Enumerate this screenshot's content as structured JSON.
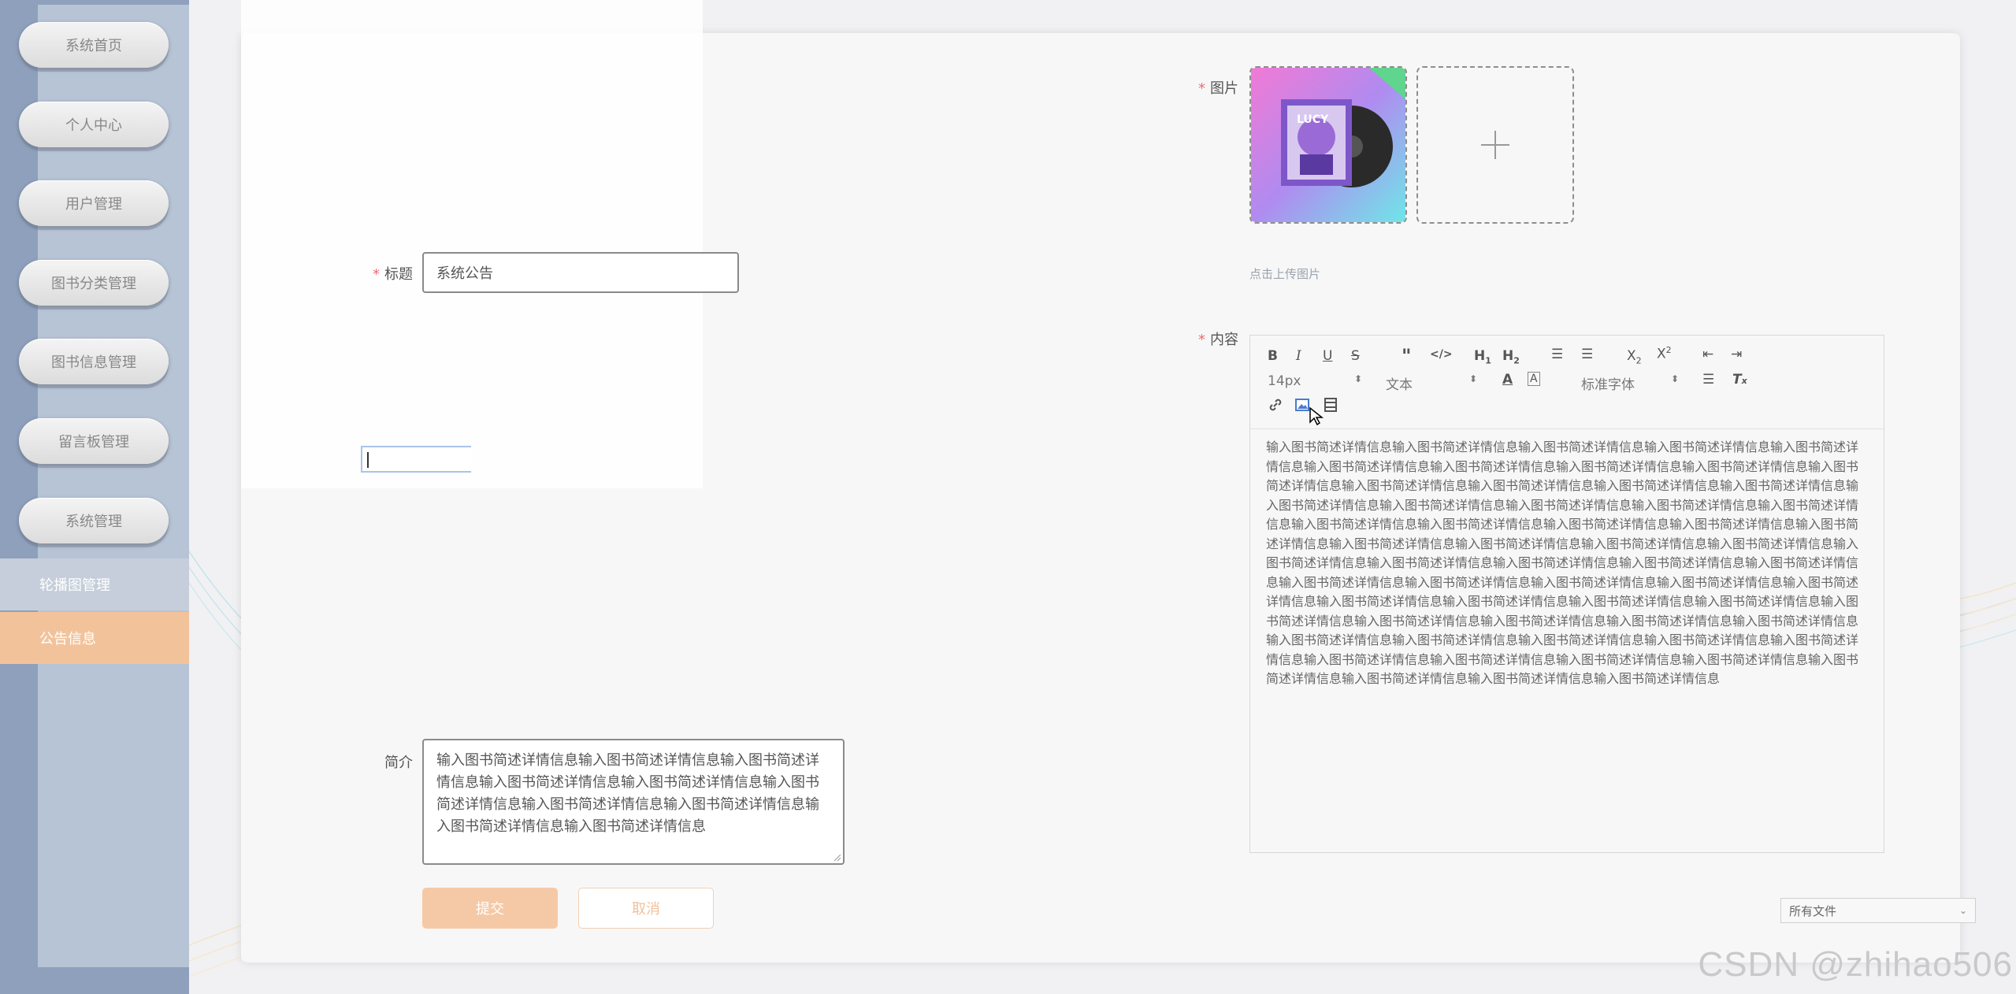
{
  "sidebar": {
    "menu": [
      {
        "label": "系统首页"
      },
      {
        "label": "个人中心"
      },
      {
        "label": "用户管理"
      },
      {
        "label": "图书分类管理"
      },
      {
        "label": "图书信息管理"
      },
      {
        "label": "留言板管理"
      },
      {
        "label": "系统管理"
      }
    ],
    "sub_items": [
      {
        "label": "轮播图管理",
        "active": false
      },
      {
        "label": "公告信息",
        "active": true
      }
    ]
  },
  "form": {
    "title_label": "标题",
    "title_value": "系统公告",
    "image_label": "图片",
    "upload_hint": "点击上传图片",
    "content_label": "内容",
    "intro_label": "简介",
    "intro_value": "输入图书简述详情信息输入图书简述详情信息输入图书简述详情信息输入图书简述详情信息输入图书简述详情信息输入图书简述详情信息输入图书简述详情信息输入图书简述详情信息输入图书简述详情信息输入图书简述详情信息",
    "submit_label": "提交",
    "cancel_label": "取消"
  },
  "editor": {
    "font_size": "14px",
    "paragraph": "文本",
    "font_family": "标准字体",
    "content": "输入图书简述详情信息输入图书简述详情信息输入图书简述详情信息输入图书简述详情信息输入图书简述详情信息输入图书简述详情信息输入图书简述详情信息输入图书简述详情信息输入图书简述详情信息输入图书简述详情信息输入图书简述详情信息输入图书简述详情信息输入图书简述详情信息输入图书简述详情信息输入图书简述详情信息输入图书简述详情信息输入图书简述详情信息输入图书简述详情信息输入图书简述详情信息输入图书简述详情信息输入图书简述详情信息输入图书简述详情信息输入图书简述详情信息输入图书简述详情信息输入图书简述详情信息输入图书简述详情信息输入图书简述详情信息输入图书简述详情信息输入图书简述详情信息输入图书简述详情信息输入图书简述详情信息输入图书简述详情信息输入图书简述详情信息输入图书简述详情信息输入图书简述详情信息输入图书简述详情信息输入图书简述详情信息输入图书简述详情信息输入图书简述详情信息输入图书简述详情信息输入图书简述详情信息输入图书简述详情信息输入图书简述详情信息输入图书简述详情信息输入图书简述详情信息输入图书简述详情信息输入图书简述详情信息输入图书简述详情信息输入图书简述详情信息输入图书简述详情信息输入图书简述详情信息输入图书简述详情信息输入图书简述详情信息输入图书简述详情信息输入图书简述详情信息输入图书简述详情信息输入图书简述详情信息输入图书简述详情信息输入图书简述详情信息输入图书简述详情信息"
  },
  "file_select": {
    "value": "所有文件"
  },
  "watermark": "CSDN @zhihao506",
  "colors": {
    "sidebar": "#8ea0bc",
    "active_item": "#f2c39b",
    "primary_button": "#f6c9a6",
    "required": "#f06b6b"
  }
}
